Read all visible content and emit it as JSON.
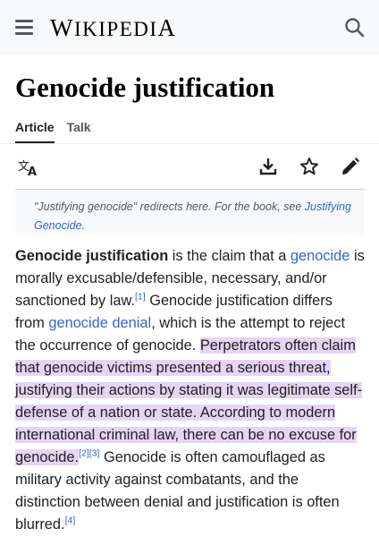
{
  "header": {
    "logo_first": "W",
    "logo_mid": "IKIPEDI",
    "logo_last": "A",
    "menu_icon": "hamburger-menu-icon",
    "search_icon": "search-icon"
  },
  "page": {
    "title": "Genocide justification"
  },
  "tabs": [
    {
      "label": "Article",
      "active": true
    },
    {
      "label": "Talk",
      "active": false
    }
  ],
  "actions": {
    "language_icon": "translate-icon",
    "download_icon": "download-icon",
    "watch_icon": "star-icon",
    "edit_icon": "pencil-icon"
  },
  "hatnote": {
    "text_before": "\"Justifying genocide\" redirects here. For the book, see ",
    "link": "Justifying Genocide",
    "text_after": "."
  },
  "article": {
    "lead_bold": "Genocide justification",
    "t1": " is the claim that a ",
    "link_genocide": "genocide",
    "t2": " is morally excusable/defensible, necessary, and/or sanctioned by law.",
    "ref1": "[1]",
    "t3": " Genocide justification differs from ",
    "link_denial": "genocide denial",
    "t4": ", which is the attempt to reject the occurrence of genocide. ",
    "highlight": "Perpetrators often claim that genocide victims presented a serious threat, justifying their actions by stating it was legitimate self-defense of a nation or state. According to modern international criminal law, there can be no excuse for genocide.",
    "ref2": "[2]",
    "ref3": "[3]",
    "t5": " Genocide is often camouflaged as military activity against combatants, and the distinction between denial and justification is often blurred.",
    "ref4": "[4]"
  },
  "colors": {
    "link": "#3366cc",
    "highlight": "#e7d4f5",
    "header_bg": "#f8f9fa"
  }
}
